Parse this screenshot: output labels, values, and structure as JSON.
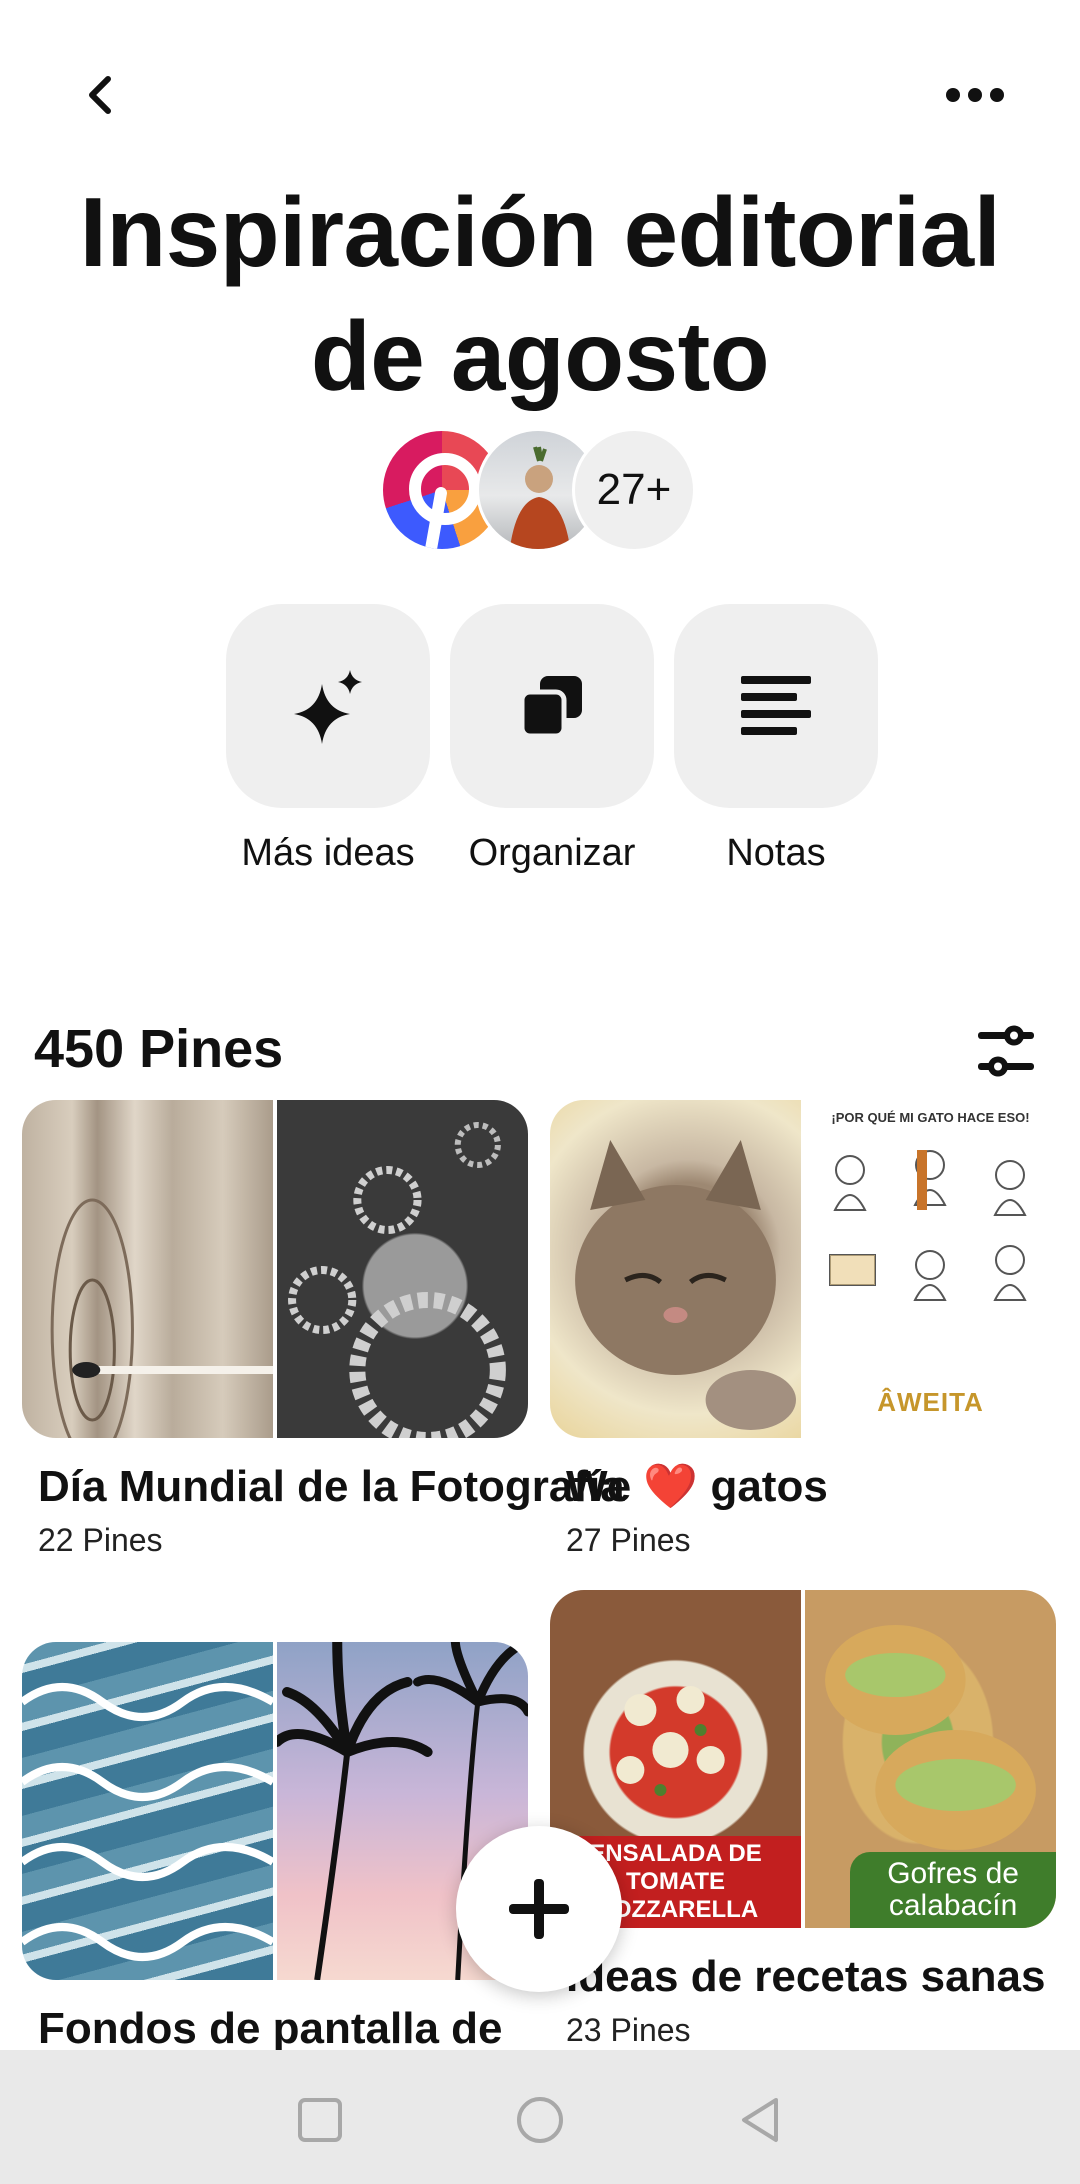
{
  "board": {
    "title": "Inspiración editorial de agosto",
    "collaborators_overflow": "27+"
  },
  "actions": [
    {
      "label": "Más ideas",
      "icon": "sparkle-icon"
    },
    {
      "label": "Organizar",
      "icon": "organize-icon"
    },
    {
      "label": "Notas",
      "icon": "notes-icon"
    }
  ],
  "pins_count": "450 Pines",
  "sections": [
    {
      "name": "Día Mundial de la Fotografía",
      "pins": "22 Pines"
    },
    {
      "name": "We ❤️ gatos",
      "pins": "27 Pines"
    },
    {
      "name": "Fondos de pantalla de",
      "pins": ""
    },
    {
      "name": "Ideas de recetas sanas",
      "pins": "23 Pines"
    }
  ],
  "cover_text": {
    "cat_info_title": "¡POR QUÉ MI GATO HACE ESO!",
    "cat_info_brand": "ÂWEITA",
    "salad_caption": "ENSALADA DE TOMATE MOZZARELLA",
    "waffle_caption": "Gofres de calabacín"
  },
  "icons": {
    "back": "back-arrow-icon",
    "more": "more-options-icon",
    "filter": "filter-icon",
    "add": "plus-icon"
  },
  "colors": {
    "tile_bg": "#efefef",
    "text": "#111111",
    "navbar_bg": "#e9e9e9"
  }
}
